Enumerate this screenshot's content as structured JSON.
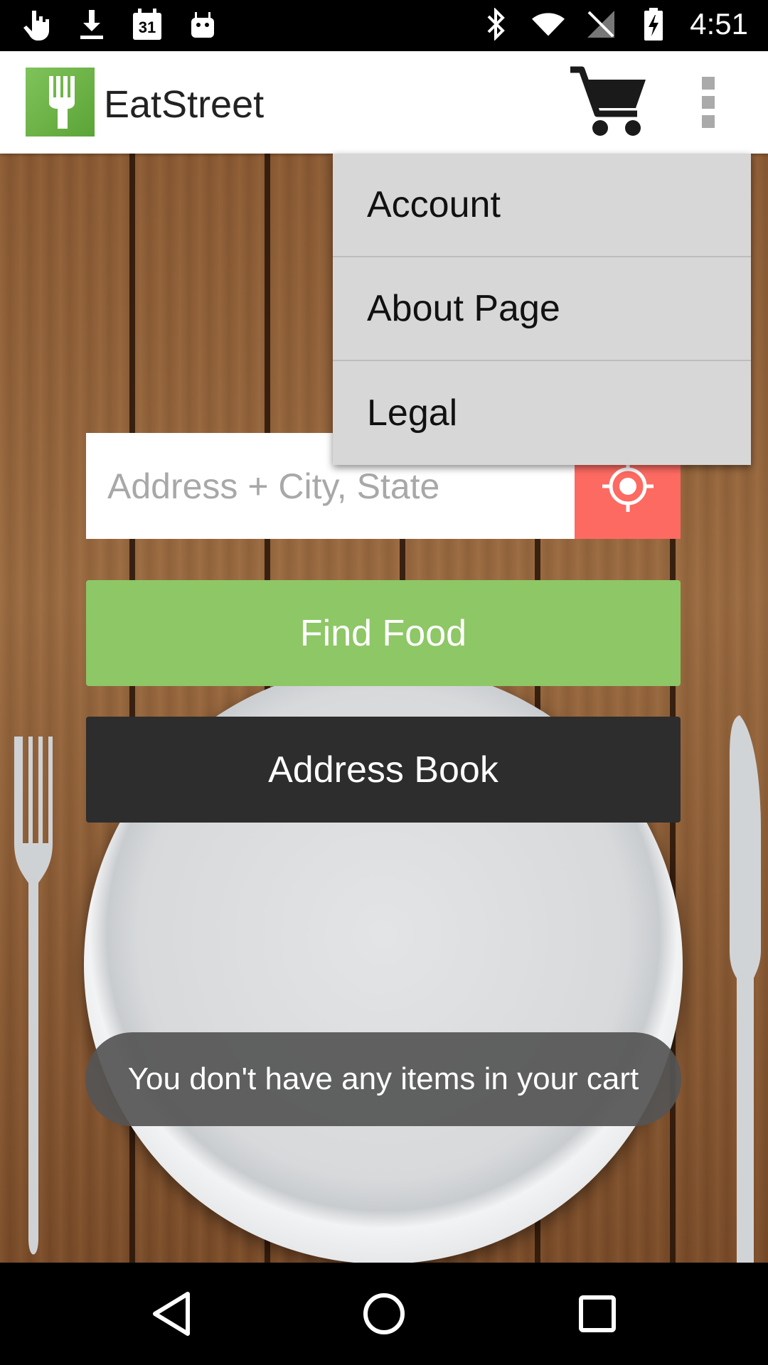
{
  "status_bar": {
    "time": "4:51",
    "left_icons": [
      "hand-icon",
      "download-icon",
      "calendar-icon",
      "android-icon"
    ],
    "calendar_day": "31",
    "right_icons": [
      "bluetooth-icon",
      "wifi-icon",
      "no-signal-icon",
      "battery-charging-icon"
    ]
  },
  "action_bar": {
    "title": "EatStreet",
    "logo_icon": "fork-logo-icon",
    "cart_icon": "cart-icon",
    "overflow_icon": "more-vert-icon"
  },
  "overflow_menu": {
    "items": [
      {
        "label": "Account"
      },
      {
        "label": "About Page"
      },
      {
        "label": "Legal"
      }
    ]
  },
  "search": {
    "placeholder": "Address + City, State",
    "value": "",
    "locate_icon": "crosshair-icon"
  },
  "buttons": {
    "find_food": "Find Food",
    "address_book": "Address Book"
  },
  "toast": {
    "message": "You don't have any items in your cart"
  },
  "colors": {
    "brand_green": "#8ec766",
    "locate_red": "#fd6a62",
    "dark_button": "#2d2d2d",
    "menu_bg": "#d7d7d7"
  },
  "nav_bar": {
    "icons": [
      "back-icon",
      "home-icon",
      "recents-icon"
    ]
  }
}
